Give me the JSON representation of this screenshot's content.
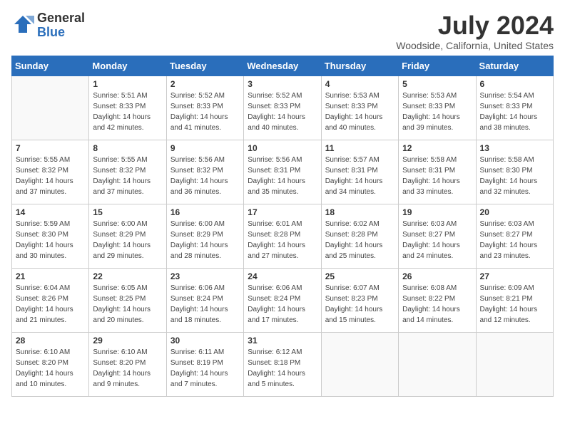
{
  "logo": {
    "general": "General",
    "blue": "Blue"
  },
  "title": "July 2024",
  "subtitle": "Woodside, California, United States",
  "days_of_week": [
    "Sunday",
    "Monday",
    "Tuesday",
    "Wednesday",
    "Thursday",
    "Friday",
    "Saturday"
  ],
  "weeks": [
    [
      {
        "num": "",
        "sunrise": "",
        "sunset": "",
        "daylight": ""
      },
      {
        "num": "1",
        "sunrise": "Sunrise: 5:51 AM",
        "sunset": "Sunset: 8:33 PM",
        "daylight": "Daylight: 14 hours and 42 minutes."
      },
      {
        "num": "2",
        "sunrise": "Sunrise: 5:52 AM",
        "sunset": "Sunset: 8:33 PM",
        "daylight": "Daylight: 14 hours and 41 minutes."
      },
      {
        "num": "3",
        "sunrise": "Sunrise: 5:52 AM",
        "sunset": "Sunset: 8:33 PM",
        "daylight": "Daylight: 14 hours and 40 minutes."
      },
      {
        "num": "4",
        "sunrise": "Sunrise: 5:53 AM",
        "sunset": "Sunset: 8:33 PM",
        "daylight": "Daylight: 14 hours and 40 minutes."
      },
      {
        "num": "5",
        "sunrise": "Sunrise: 5:53 AM",
        "sunset": "Sunset: 8:33 PM",
        "daylight": "Daylight: 14 hours and 39 minutes."
      },
      {
        "num": "6",
        "sunrise": "Sunrise: 5:54 AM",
        "sunset": "Sunset: 8:33 PM",
        "daylight": "Daylight: 14 hours and 38 minutes."
      }
    ],
    [
      {
        "num": "7",
        "sunrise": "Sunrise: 5:55 AM",
        "sunset": "Sunset: 8:32 PM",
        "daylight": "Daylight: 14 hours and 37 minutes."
      },
      {
        "num": "8",
        "sunrise": "Sunrise: 5:55 AM",
        "sunset": "Sunset: 8:32 PM",
        "daylight": "Daylight: 14 hours and 37 minutes."
      },
      {
        "num": "9",
        "sunrise": "Sunrise: 5:56 AM",
        "sunset": "Sunset: 8:32 PM",
        "daylight": "Daylight: 14 hours and 36 minutes."
      },
      {
        "num": "10",
        "sunrise": "Sunrise: 5:56 AM",
        "sunset": "Sunset: 8:31 PM",
        "daylight": "Daylight: 14 hours and 35 minutes."
      },
      {
        "num": "11",
        "sunrise": "Sunrise: 5:57 AM",
        "sunset": "Sunset: 8:31 PM",
        "daylight": "Daylight: 14 hours and 34 minutes."
      },
      {
        "num": "12",
        "sunrise": "Sunrise: 5:58 AM",
        "sunset": "Sunset: 8:31 PM",
        "daylight": "Daylight: 14 hours and 33 minutes."
      },
      {
        "num": "13",
        "sunrise": "Sunrise: 5:58 AM",
        "sunset": "Sunset: 8:30 PM",
        "daylight": "Daylight: 14 hours and 32 minutes."
      }
    ],
    [
      {
        "num": "14",
        "sunrise": "Sunrise: 5:59 AM",
        "sunset": "Sunset: 8:30 PM",
        "daylight": "Daylight: 14 hours and 30 minutes."
      },
      {
        "num": "15",
        "sunrise": "Sunrise: 6:00 AM",
        "sunset": "Sunset: 8:29 PM",
        "daylight": "Daylight: 14 hours and 29 minutes."
      },
      {
        "num": "16",
        "sunrise": "Sunrise: 6:00 AM",
        "sunset": "Sunset: 8:29 PM",
        "daylight": "Daylight: 14 hours and 28 minutes."
      },
      {
        "num": "17",
        "sunrise": "Sunrise: 6:01 AM",
        "sunset": "Sunset: 8:28 PM",
        "daylight": "Daylight: 14 hours and 27 minutes."
      },
      {
        "num": "18",
        "sunrise": "Sunrise: 6:02 AM",
        "sunset": "Sunset: 8:28 PM",
        "daylight": "Daylight: 14 hours and 25 minutes."
      },
      {
        "num": "19",
        "sunrise": "Sunrise: 6:03 AM",
        "sunset": "Sunset: 8:27 PM",
        "daylight": "Daylight: 14 hours and 24 minutes."
      },
      {
        "num": "20",
        "sunrise": "Sunrise: 6:03 AM",
        "sunset": "Sunset: 8:27 PM",
        "daylight": "Daylight: 14 hours and 23 minutes."
      }
    ],
    [
      {
        "num": "21",
        "sunrise": "Sunrise: 6:04 AM",
        "sunset": "Sunset: 8:26 PM",
        "daylight": "Daylight: 14 hours and 21 minutes."
      },
      {
        "num": "22",
        "sunrise": "Sunrise: 6:05 AM",
        "sunset": "Sunset: 8:25 PM",
        "daylight": "Daylight: 14 hours and 20 minutes."
      },
      {
        "num": "23",
        "sunrise": "Sunrise: 6:06 AM",
        "sunset": "Sunset: 8:24 PM",
        "daylight": "Daylight: 14 hours and 18 minutes."
      },
      {
        "num": "24",
        "sunrise": "Sunrise: 6:06 AM",
        "sunset": "Sunset: 8:24 PM",
        "daylight": "Daylight: 14 hours and 17 minutes."
      },
      {
        "num": "25",
        "sunrise": "Sunrise: 6:07 AM",
        "sunset": "Sunset: 8:23 PM",
        "daylight": "Daylight: 14 hours and 15 minutes."
      },
      {
        "num": "26",
        "sunrise": "Sunrise: 6:08 AM",
        "sunset": "Sunset: 8:22 PM",
        "daylight": "Daylight: 14 hours and 14 minutes."
      },
      {
        "num": "27",
        "sunrise": "Sunrise: 6:09 AM",
        "sunset": "Sunset: 8:21 PM",
        "daylight": "Daylight: 14 hours and 12 minutes."
      }
    ],
    [
      {
        "num": "28",
        "sunrise": "Sunrise: 6:10 AM",
        "sunset": "Sunset: 8:20 PM",
        "daylight": "Daylight: 14 hours and 10 minutes."
      },
      {
        "num": "29",
        "sunrise": "Sunrise: 6:10 AM",
        "sunset": "Sunset: 8:20 PM",
        "daylight": "Daylight: 14 hours and 9 minutes."
      },
      {
        "num": "30",
        "sunrise": "Sunrise: 6:11 AM",
        "sunset": "Sunset: 8:19 PM",
        "daylight": "Daylight: 14 hours and 7 minutes."
      },
      {
        "num": "31",
        "sunrise": "Sunrise: 6:12 AM",
        "sunset": "Sunset: 8:18 PM",
        "daylight": "Daylight: 14 hours and 5 minutes."
      },
      {
        "num": "",
        "sunrise": "",
        "sunset": "",
        "daylight": ""
      },
      {
        "num": "",
        "sunrise": "",
        "sunset": "",
        "daylight": ""
      },
      {
        "num": "",
        "sunrise": "",
        "sunset": "",
        "daylight": ""
      }
    ]
  ]
}
